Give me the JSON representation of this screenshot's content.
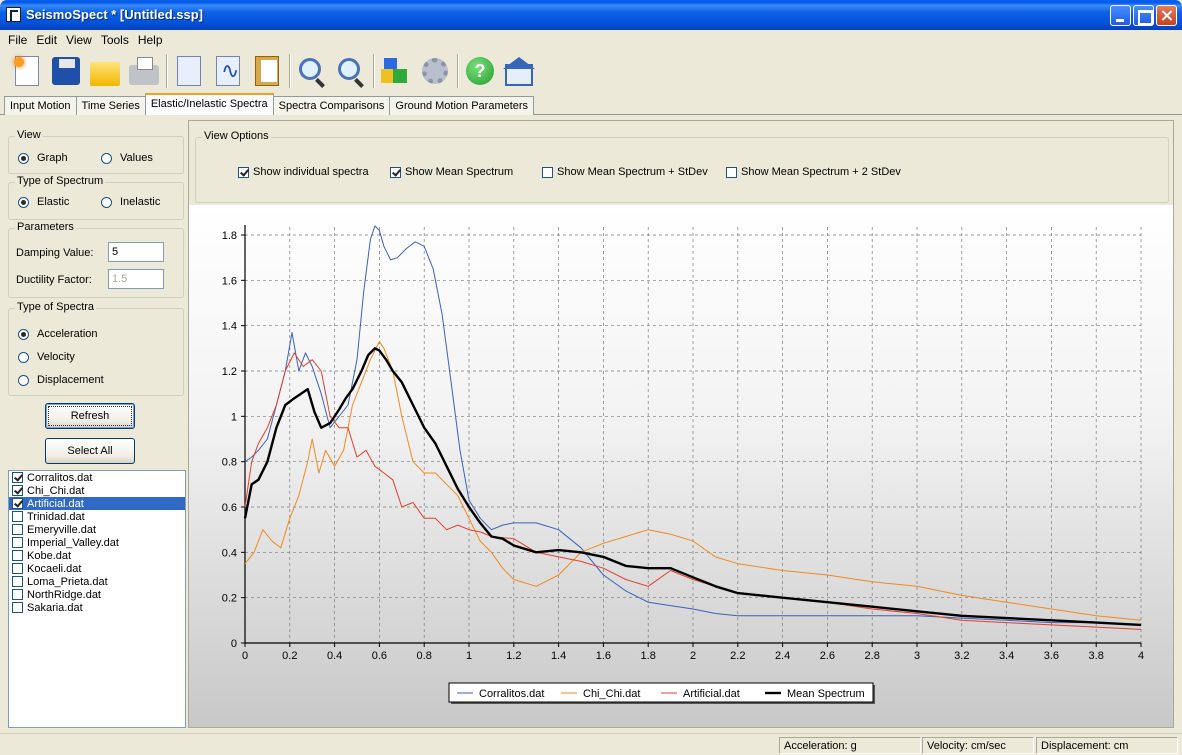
{
  "window": {
    "title": "SeismoSpect * [Untitled.ssp]"
  },
  "menu": [
    "File",
    "Edit",
    "View",
    "Tools",
    "Help"
  ],
  "toolbar": {
    "icons": [
      "new-document-icon",
      "save-icon",
      "open-folder-icon",
      "print-icon",
      "copy-document-icon",
      "waveform-document-icon",
      "paste-clipboard-icon",
      "zoom-in-icon",
      "zoom-out-icon",
      "cubes-icon",
      "settings-gear-icon",
      "help-icon",
      "home-icon"
    ],
    "help_glyph": "?"
  },
  "tabs": [
    {
      "label": "Input Motion",
      "active": false
    },
    {
      "label": "Time Series",
      "active": false
    },
    {
      "label": "Elastic/Inelastic Spectra",
      "active": true
    },
    {
      "label": "Spectra Comparisons",
      "active": false
    },
    {
      "label": "Ground Motion Parameters",
      "active": false
    }
  ],
  "left": {
    "view": {
      "title": "View",
      "options": [
        "Graph",
        "Values"
      ],
      "selected": "Graph"
    },
    "spectrum_type": {
      "title": "Type of Spectrum",
      "options": [
        "Elastic",
        "Inelastic"
      ],
      "selected": "Elastic"
    },
    "parameters": {
      "title": "Parameters",
      "damping_label": "Damping Value:",
      "damping_value": "5",
      "ductility_label": "Ductility Factor:",
      "ductility_value": "1.5"
    },
    "spectra_type": {
      "title": "Type of Spectra",
      "options": [
        "Acceleration",
        "Velocity",
        "Displacement"
      ],
      "selected": "Acceleration"
    },
    "refresh_label": "Refresh",
    "select_all_label": "Select All",
    "files": [
      {
        "name": "Corralitos.dat",
        "checked": true,
        "selected": false
      },
      {
        "name": "Chi_Chi.dat",
        "checked": true,
        "selected": false
      },
      {
        "name": "Artificial.dat",
        "checked": true,
        "selected": true
      },
      {
        "name": "Trinidad.dat",
        "checked": false,
        "selected": false
      },
      {
        "name": "Emeryville.dat",
        "checked": false,
        "selected": false
      },
      {
        "name": "Imperial_Valley.dat",
        "checked": false,
        "selected": false
      },
      {
        "name": "Kobe.dat",
        "checked": false,
        "selected": false
      },
      {
        "name": "Kocaeli.dat",
        "checked": false,
        "selected": false
      },
      {
        "name": "Loma_Prieta.dat",
        "checked": false,
        "selected": false
      },
      {
        "name": "NorthRidge.dat",
        "checked": false,
        "selected": false
      },
      {
        "name": "Sakaria.dat",
        "checked": false,
        "selected": false
      }
    ]
  },
  "view_options": {
    "title": "View Options",
    "options": [
      {
        "label": "Show individual spectra",
        "checked": true
      },
      {
        "label": "Show Mean Spectrum",
        "checked": true
      },
      {
        "label": "Show Mean Spectrum + StDev",
        "checked": false
      },
      {
        "label": "Show Mean Spectrum + 2 StDev",
        "checked": false
      }
    ]
  },
  "chart_data": {
    "type": "line",
    "xlim": [
      0,
      4
    ],
    "ylim": [
      0,
      1.8
    ],
    "xticks": [
      "0",
      "0.2",
      "0.4",
      "0.6",
      "0.8",
      "1",
      "1.2",
      "1.4",
      "1.6",
      "1.8",
      "2",
      "2.2",
      "2.4",
      "2.6",
      "2.8",
      "3",
      "3.2",
      "3.4",
      "3.6",
      "3.8",
      "4"
    ],
    "yticks": [
      "0",
      "0.2",
      "0.4",
      "0.6",
      "0.8",
      "1",
      "1.2",
      "1.4",
      "1.6",
      "1.8"
    ],
    "grid": true,
    "legend": "bottom-center",
    "series": [
      {
        "name": "Corralitos.dat",
        "color": "#3a62b8",
        "width": 1,
        "x": [
          0,
          0.03,
          0.06,
          0.1,
          0.14,
          0.18,
          0.21,
          0.24,
          0.27,
          0.3,
          0.34,
          0.38,
          0.42,
          0.46,
          0.5,
          0.53,
          0.56,
          0.58,
          0.6,
          0.62,
          0.65,
          0.68,
          0.72,
          0.76,
          0.8,
          0.84,
          0.88,
          0.92,
          0.96,
          1.0,
          1.05,
          1.1,
          1.15,
          1.2,
          1.3,
          1.4,
          1.5,
          1.6,
          1.7,
          1.8,
          2.0,
          2.1,
          2.2,
          2.4,
          2.6,
          2.8,
          3.0,
          3.2,
          3.4,
          3.6,
          3.8,
          4.0
        ],
        "y": [
          0.8,
          0.82,
          0.85,
          0.9,
          1.05,
          1.2,
          1.37,
          1.2,
          1.28,
          1.22,
          1.1,
          0.95,
          1.0,
          1.05,
          1.25,
          1.55,
          1.78,
          1.84,
          1.82,
          1.75,
          1.69,
          1.7,
          1.74,
          1.77,
          1.75,
          1.65,
          1.45,
          1.15,
          0.85,
          0.63,
          0.55,
          0.5,
          0.52,
          0.53,
          0.53,
          0.5,
          0.42,
          0.3,
          0.23,
          0.18,
          0.15,
          0.13,
          0.12,
          0.12,
          0.12,
          0.12,
          0.12,
          0.11,
          0.1,
          0.09,
          0.09,
          0.08
        ]
      },
      {
        "name": "Chi_Chi.dat",
        "color": "#f08a1c",
        "width": 1,
        "x": [
          0,
          0.04,
          0.08,
          0.12,
          0.16,
          0.2,
          0.24,
          0.28,
          0.3,
          0.33,
          0.36,
          0.4,
          0.44,
          0.48,
          0.52,
          0.56,
          0.6,
          0.62,
          0.66,
          0.7,
          0.75,
          0.8,
          0.85,
          0.9,
          0.95,
          1.0,
          1.05,
          1.1,
          1.15,
          1.2,
          1.3,
          1.4,
          1.5,
          1.6,
          1.7,
          1.8,
          1.9,
          2.0,
          2.1,
          2.2,
          2.4,
          2.6,
          2.8,
          3.0,
          3.2,
          3.4,
          3.6,
          3.8,
          4.0
        ],
        "y": [
          0.35,
          0.4,
          0.5,
          0.45,
          0.42,
          0.55,
          0.65,
          0.8,
          0.9,
          0.75,
          0.85,
          0.78,
          0.85,
          1.05,
          1.15,
          1.25,
          1.33,
          1.3,
          1.2,
          1.0,
          0.8,
          0.75,
          0.75,
          0.7,
          0.65,
          0.55,
          0.45,
          0.4,
          0.33,
          0.28,
          0.25,
          0.3,
          0.4,
          0.44,
          0.47,
          0.5,
          0.48,
          0.45,
          0.38,
          0.35,
          0.32,
          0.3,
          0.27,
          0.25,
          0.21,
          0.18,
          0.15,
          0.12,
          0.1
        ]
      },
      {
        "name": "Artificial.dat",
        "color": "#e0412c",
        "width": 1,
        "x": [
          0,
          0.03,
          0.06,
          0.1,
          0.14,
          0.18,
          0.22,
          0.26,
          0.3,
          0.34,
          0.38,
          0.42,
          0.46,
          0.5,
          0.54,
          0.58,
          0.62,
          0.66,
          0.7,
          0.75,
          0.8,
          0.85,
          0.9,
          0.95,
          1.0,
          1.05,
          1.1,
          1.2,
          1.3,
          1.4,
          1.5,
          1.6,
          1.7,
          1.8,
          1.9,
          2.0,
          2.2,
          2.4,
          2.6,
          2.8,
          3.0,
          3.2,
          3.4,
          3.6,
          3.8,
          4.0
        ],
        "y": [
          0.6,
          0.8,
          0.88,
          0.95,
          1.05,
          1.2,
          1.28,
          1.22,
          1.25,
          1.2,
          1.0,
          0.95,
          0.95,
          0.82,
          0.85,
          0.78,
          0.75,
          0.72,
          0.6,
          0.62,
          0.55,
          0.55,
          0.5,
          0.52,
          0.5,
          0.49,
          0.47,
          0.46,
          0.4,
          0.38,
          0.36,
          0.33,
          0.28,
          0.25,
          0.32,
          0.28,
          0.22,
          0.2,
          0.18,
          0.15,
          0.13,
          0.1,
          0.09,
          0.08,
          0.07,
          0.06
        ]
      },
      {
        "name": "Mean Spectrum",
        "color": "#000000",
        "width": 2.4,
        "x": [
          0,
          0.03,
          0.06,
          0.1,
          0.14,
          0.18,
          0.22,
          0.25,
          0.28,
          0.31,
          0.34,
          0.38,
          0.42,
          0.45,
          0.48,
          0.52,
          0.55,
          0.58,
          0.6,
          0.63,
          0.66,
          0.7,
          0.75,
          0.8,
          0.85,
          0.9,
          0.95,
          1.0,
          1.05,
          1.1,
          1.15,
          1.2,
          1.3,
          1.4,
          1.5,
          1.6,
          1.7,
          1.8,
          1.9,
          2.0,
          2.1,
          2.2,
          2.4,
          2.6,
          2.8,
          3.0,
          3.2,
          3.4,
          3.6,
          3.8,
          4.0
        ],
        "y": [
          0.55,
          0.7,
          0.72,
          0.8,
          0.95,
          1.05,
          1.08,
          1.1,
          1.12,
          1.02,
          0.95,
          0.97,
          1.03,
          1.08,
          1.12,
          1.2,
          1.27,
          1.3,
          1.29,
          1.25,
          1.2,
          1.15,
          1.05,
          0.95,
          0.88,
          0.78,
          0.68,
          0.6,
          0.53,
          0.47,
          0.46,
          0.43,
          0.4,
          0.41,
          0.4,
          0.38,
          0.34,
          0.33,
          0.33,
          0.29,
          0.25,
          0.22,
          0.2,
          0.18,
          0.16,
          0.14,
          0.12,
          0.11,
          0.1,
          0.09,
          0.08
        ]
      }
    ]
  },
  "status": {
    "acceleration": "Acceleration: g",
    "velocity": "Velocity: cm/sec",
    "displacement": "Displacement: cm"
  }
}
